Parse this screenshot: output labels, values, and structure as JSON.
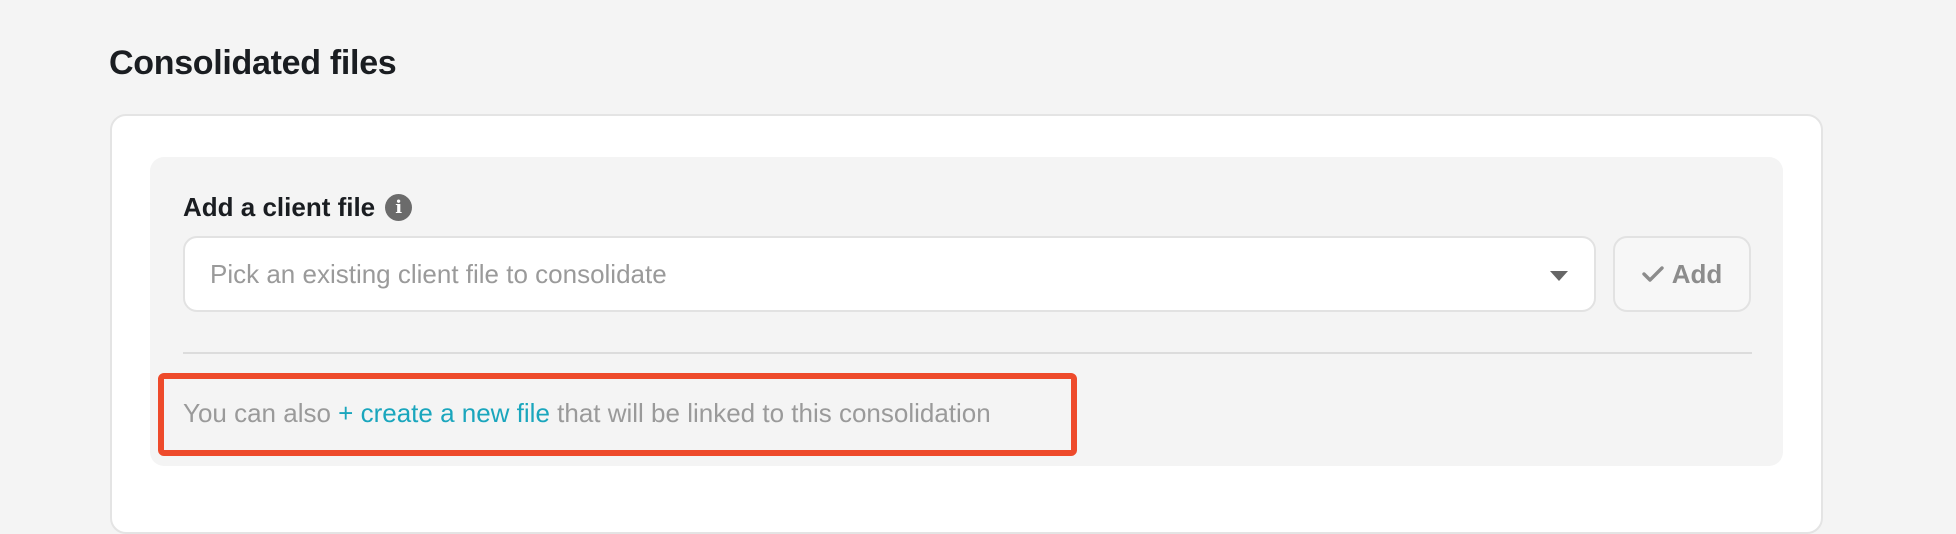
{
  "section": {
    "title": "Consolidated files"
  },
  "add_client_file": {
    "label": "Add a client file",
    "info_icon": "info-icon",
    "info_icon_glyph": "i",
    "select": {
      "placeholder": "Pick an existing client file to consolidate",
      "caret_icon": "caret-down-icon"
    },
    "add_button": {
      "label": "Add",
      "icon": "check-icon"
    }
  },
  "helper": {
    "prefix": "You can also ",
    "link_label": "+ create a new file",
    "suffix": " that will be linked to this consolidation"
  },
  "colors": {
    "link": "#1aa6bd",
    "highlight_border": "#ee4a2b",
    "text_dark": "#1a1d21",
    "text_muted": "#9a9a9a"
  }
}
